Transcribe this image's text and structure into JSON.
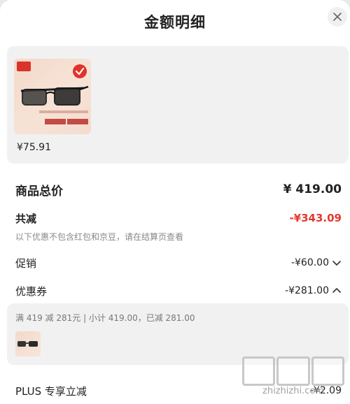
{
  "header": {
    "title": "金额明细"
  },
  "product": {
    "price": "¥75.91"
  },
  "summary": {
    "total_label": "商品总价",
    "total_value": "¥ 419.00",
    "reduce_label": "共减",
    "reduce_value": "-¥343.09",
    "note": "以下优惠不包含红包和京豆，请在结算页查看",
    "promo_label": "促销",
    "promo_value": "-¥60.00",
    "coupon_label": "优惠券",
    "coupon_value": "-¥281.00"
  },
  "coupon_detail": {
    "desc": "满 419 减 281元 | 小计 419.00，已减 281.00"
  },
  "plus": {
    "label": "PLUS 专享立减",
    "value": "-¥2.09"
  },
  "watermark": {
    "text": "zhizhizhi.com"
  },
  "colors": {
    "accent": "#e4392d",
    "card_bg": "#f1f1f1"
  },
  "icons": [
    "close-icon",
    "check-badge-icon",
    "chevron-down-icon",
    "chevron-up-icon"
  ]
}
